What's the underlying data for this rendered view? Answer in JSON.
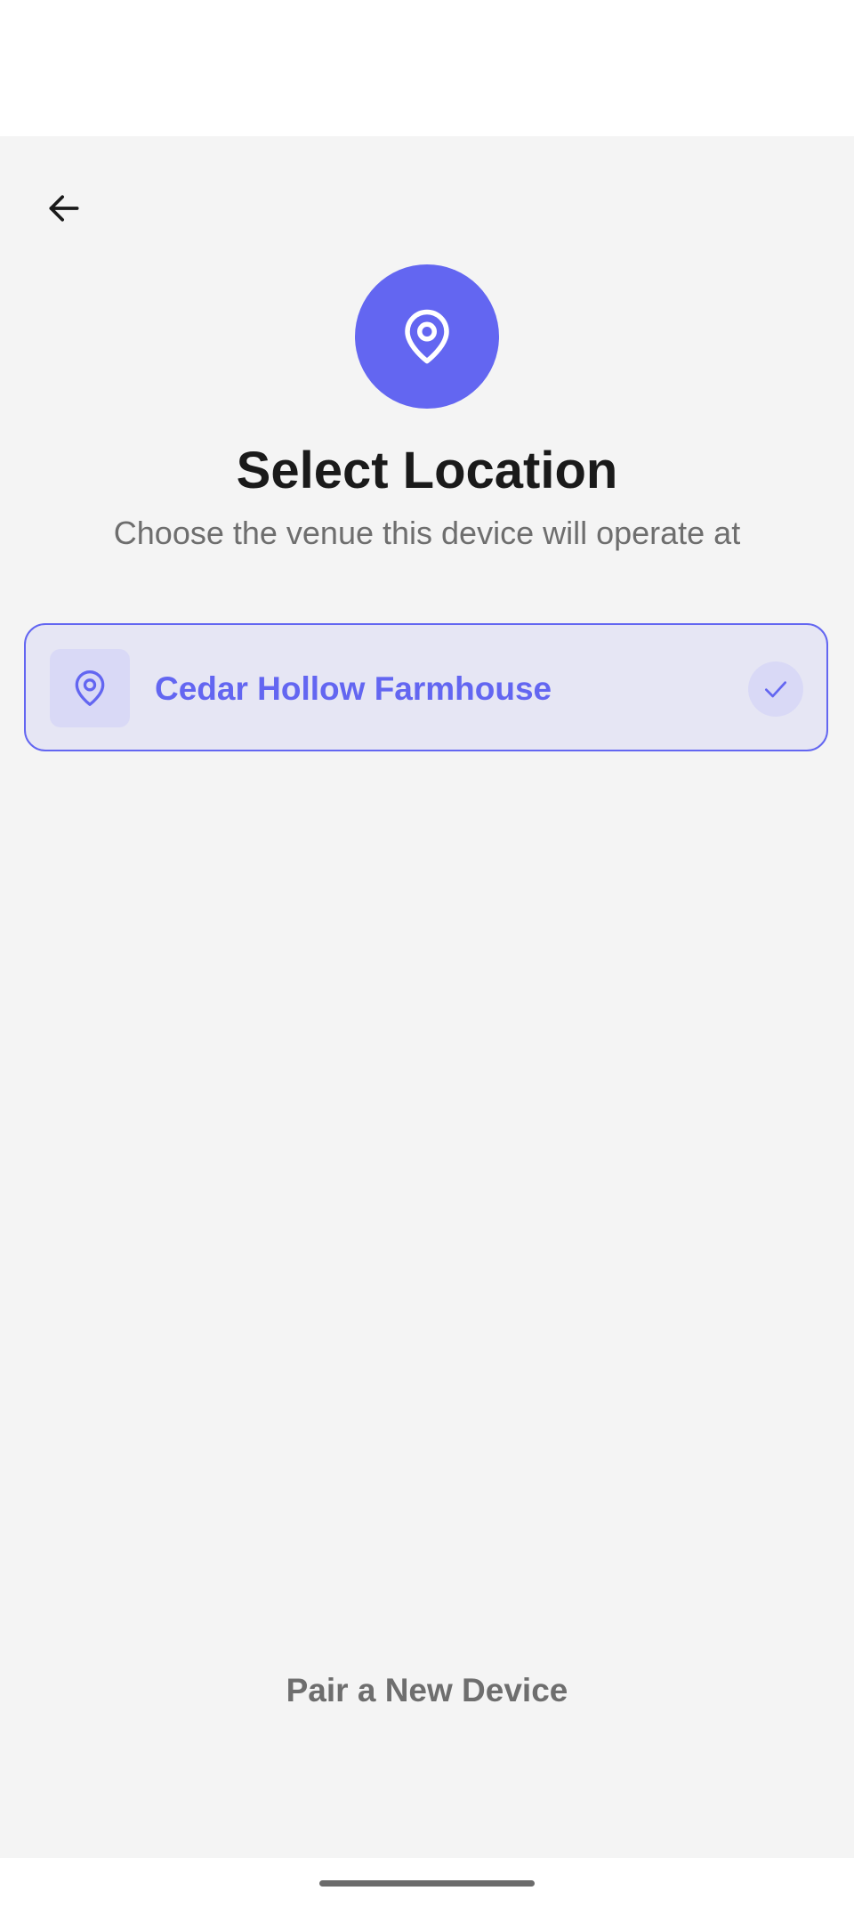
{
  "header": {
    "back_icon": "arrow-left-icon"
  },
  "hero": {
    "icon": "map-pin-icon",
    "accent_color": "#6366f1"
  },
  "title": "Select Location",
  "subtitle": "Choose the venue this device will operate at",
  "locations": [
    {
      "name": "Cedar Hollow Farmhouse",
      "icon": "map-pin-icon",
      "selected": true,
      "status_icon": "checkmark-icon"
    }
  ],
  "footer": {
    "pair_label": "Pair a New Device"
  }
}
